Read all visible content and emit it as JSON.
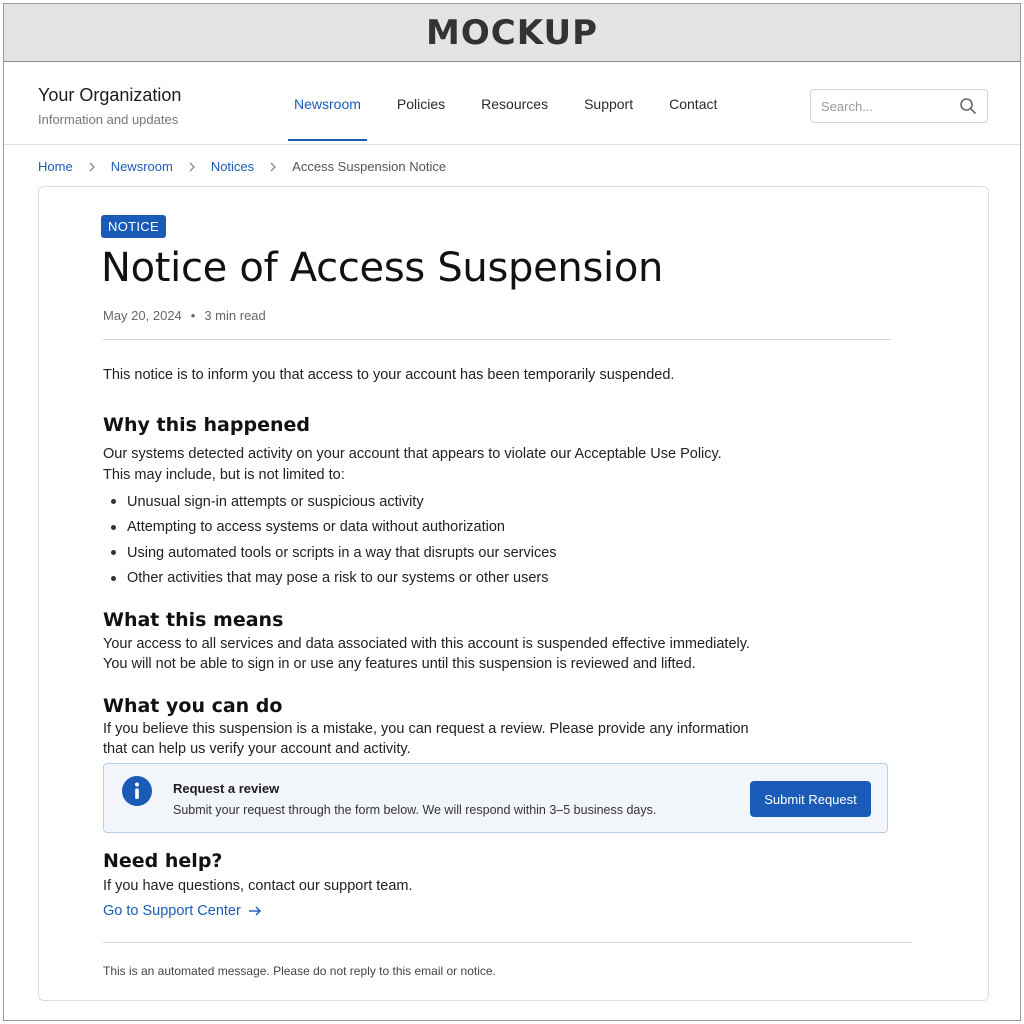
{
  "mockup_banner": "MOCKUP",
  "header": {
    "org_name": "Your Organization",
    "org_subtitle": "Information and updates",
    "nav": [
      {
        "label": "Newsroom",
        "active": true
      },
      {
        "label": "Policies",
        "active": false
      },
      {
        "label": "Resources",
        "active": false
      },
      {
        "label": "Support",
        "active": false
      },
      {
        "label": "Contact",
        "active": false
      }
    ],
    "search": {
      "placeholder": "Search...",
      "icon": "search-icon"
    }
  },
  "breadcrumb": {
    "items": [
      "Home",
      "Newsroom",
      "Notices"
    ],
    "current": "Access Suspension Notice"
  },
  "article": {
    "badge": "NOTICE",
    "title": "Notice of Access Suspension",
    "date": "May 20, 2024",
    "separator": "•",
    "read_time": "3 min read",
    "intro": "This notice is to inform you that access to your account has been temporarily suspended.",
    "why": {
      "heading": "Why this happened",
      "line1": "Our systems detected activity on your account that appears to violate our Acceptable Use Policy.",
      "line2": "This may include, but is not limited to:",
      "bullets": [
        "Unusual sign-in attempts or suspicious activity",
        "Attempting to access systems or data without authorization",
        "Using automated tools or scripts in a way that disrupts our services",
        "Other activities that may pose a risk to our systems or other users"
      ]
    },
    "means": {
      "heading": "What this means",
      "line1": "Your access to all services and data associated with this account is suspended effective immediately.",
      "line2": "You will not be able to sign in or use any features until this suspension is reviewed and lifted."
    },
    "cando": {
      "heading": "What you can do",
      "line1": "If you believe this suspension is a mistake, you can request a review. Please provide any information",
      "line2": "that can help us verify your account and activity."
    },
    "callout": {
      "icon": "info-icon",
      "title": "Request a review",
      "text": "Submit your request through the form below. We will respond within 3–5 business days.",
      "button": "Submit Request"
    },
    "help": {
      "heading": "Need help?",
      "text": "If you have questions, contact our support team.",
      "link": "Go to Support Center",
      "link_icon": "arrow-right-icon"
    },
    "footer": "This is an automated message. Please do not reply to this email or notice."
  },
  "colors": {
    "accent": "#1a5bb8",
    "callout_bg": "#f2f6fb",
    "callout_border": "#b9cde8"
  }
}
